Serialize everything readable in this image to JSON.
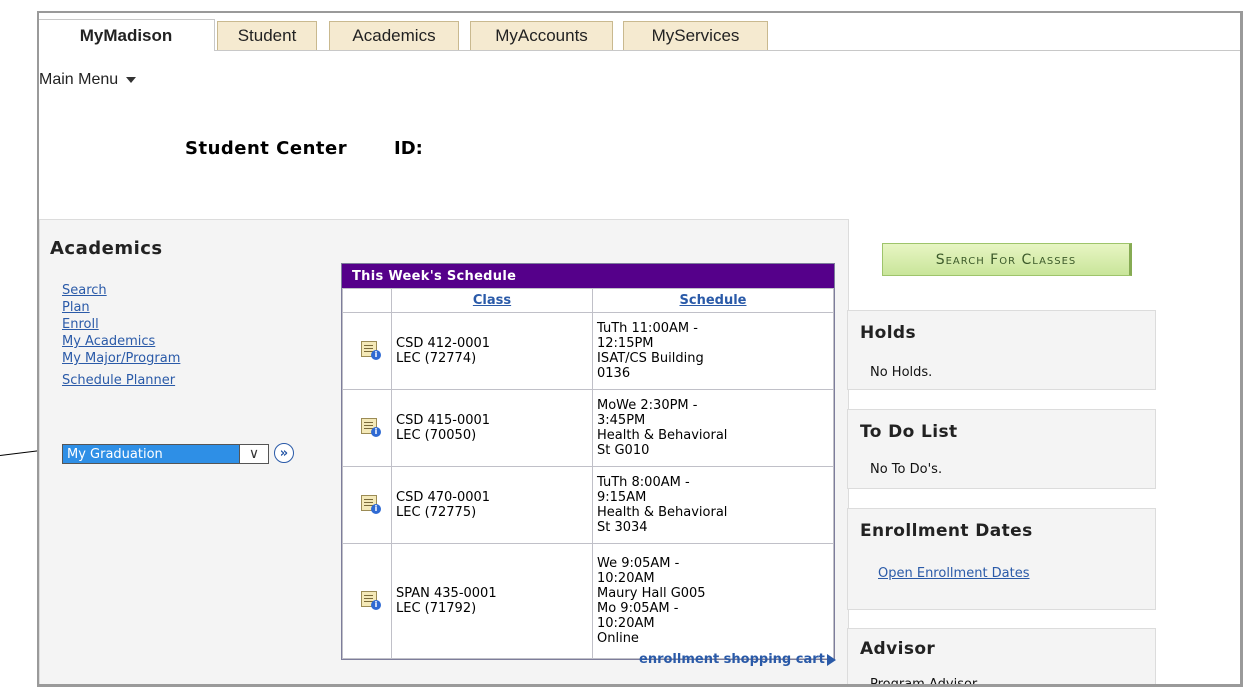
{
  "tabs": [
    {
      "label": "MyMadison",
      "active": true
    },
    {
      "label": "Student",
      "active": false
    },
    {
      "label": "Academics",
      "active": false
    },
    {
      "label": "MyAccounts",
      "active": false
    },
    {
      "label": "MyServices",
      "active": false
    }
  ],
  "main_menu": "Main Menu",
  "page": {
    "title": "Student Center",
    "id_label": "ID:"
  },
  "academics": {
    "title": "Academics",
    "links": [
      "Search",
      "Plan",
      "Enroll",
      "My Academics",
      "My Major/Program",
      "Schedule Planner"
    ],
    "select_value": "My Graduation",
    "select_arrow": "∨",
    "go_glyph": "»"
  },
  "schedule": {
    "title": "This Week's Schedule",
    "headers": [
      "Class",
      "Schedule"
    ],
    "rows": [
      {
        "class": "CSD 412-0001\nLEC (72774)",
        "schedule": "TuTh 11:00AM -\n12:15PM\nISAT/CS Building\n0136"
      },
      {
        "class": "CSD 415-0001\nLEC (70050)",
        "schedule": "MoWe 2:30PM -\n3:45PM\nHealth & Behavioral\nSt G010"
      },
      {
        "class": "CSD 470-0001\nLEC (72775)",
        "schedule": "TuTh 8:00AM -\n9:15AM\nHealth & Behavioral\nSt 3034"
      },
      {
        "class": "SPAN 435-0001\nLEC (71792)",
        "schedule": "We 9:05AM -\n10:20AM\nMaury Hall G005\nMo 9:05AM -\n10:20AM\nOnline"
      }
    ],
    "cart_link": "enrollment shopping cart"
  },
  "search_button": "Search For Classes",
  "holds": {
    "title": "Holds",
    "text": "No Holds."
  },
  "todo": {
    "title": "To Do List",
    "text": "No To Do's."
  },
  "enrollment_dates": {
    "title": "Enrollment Dates",
    "link": "Open Enrollment Dates"
  },
  "advisor": {
    "title": "Advisor",
    "text": "Program Advisor"
  },
  "colors": {
    "schedule_header": "#55008a",
    "link": "#2a5aa8",
    "search_button": "#c9e59a",
    "tab_bg": "#f5ead0"
  }
}
